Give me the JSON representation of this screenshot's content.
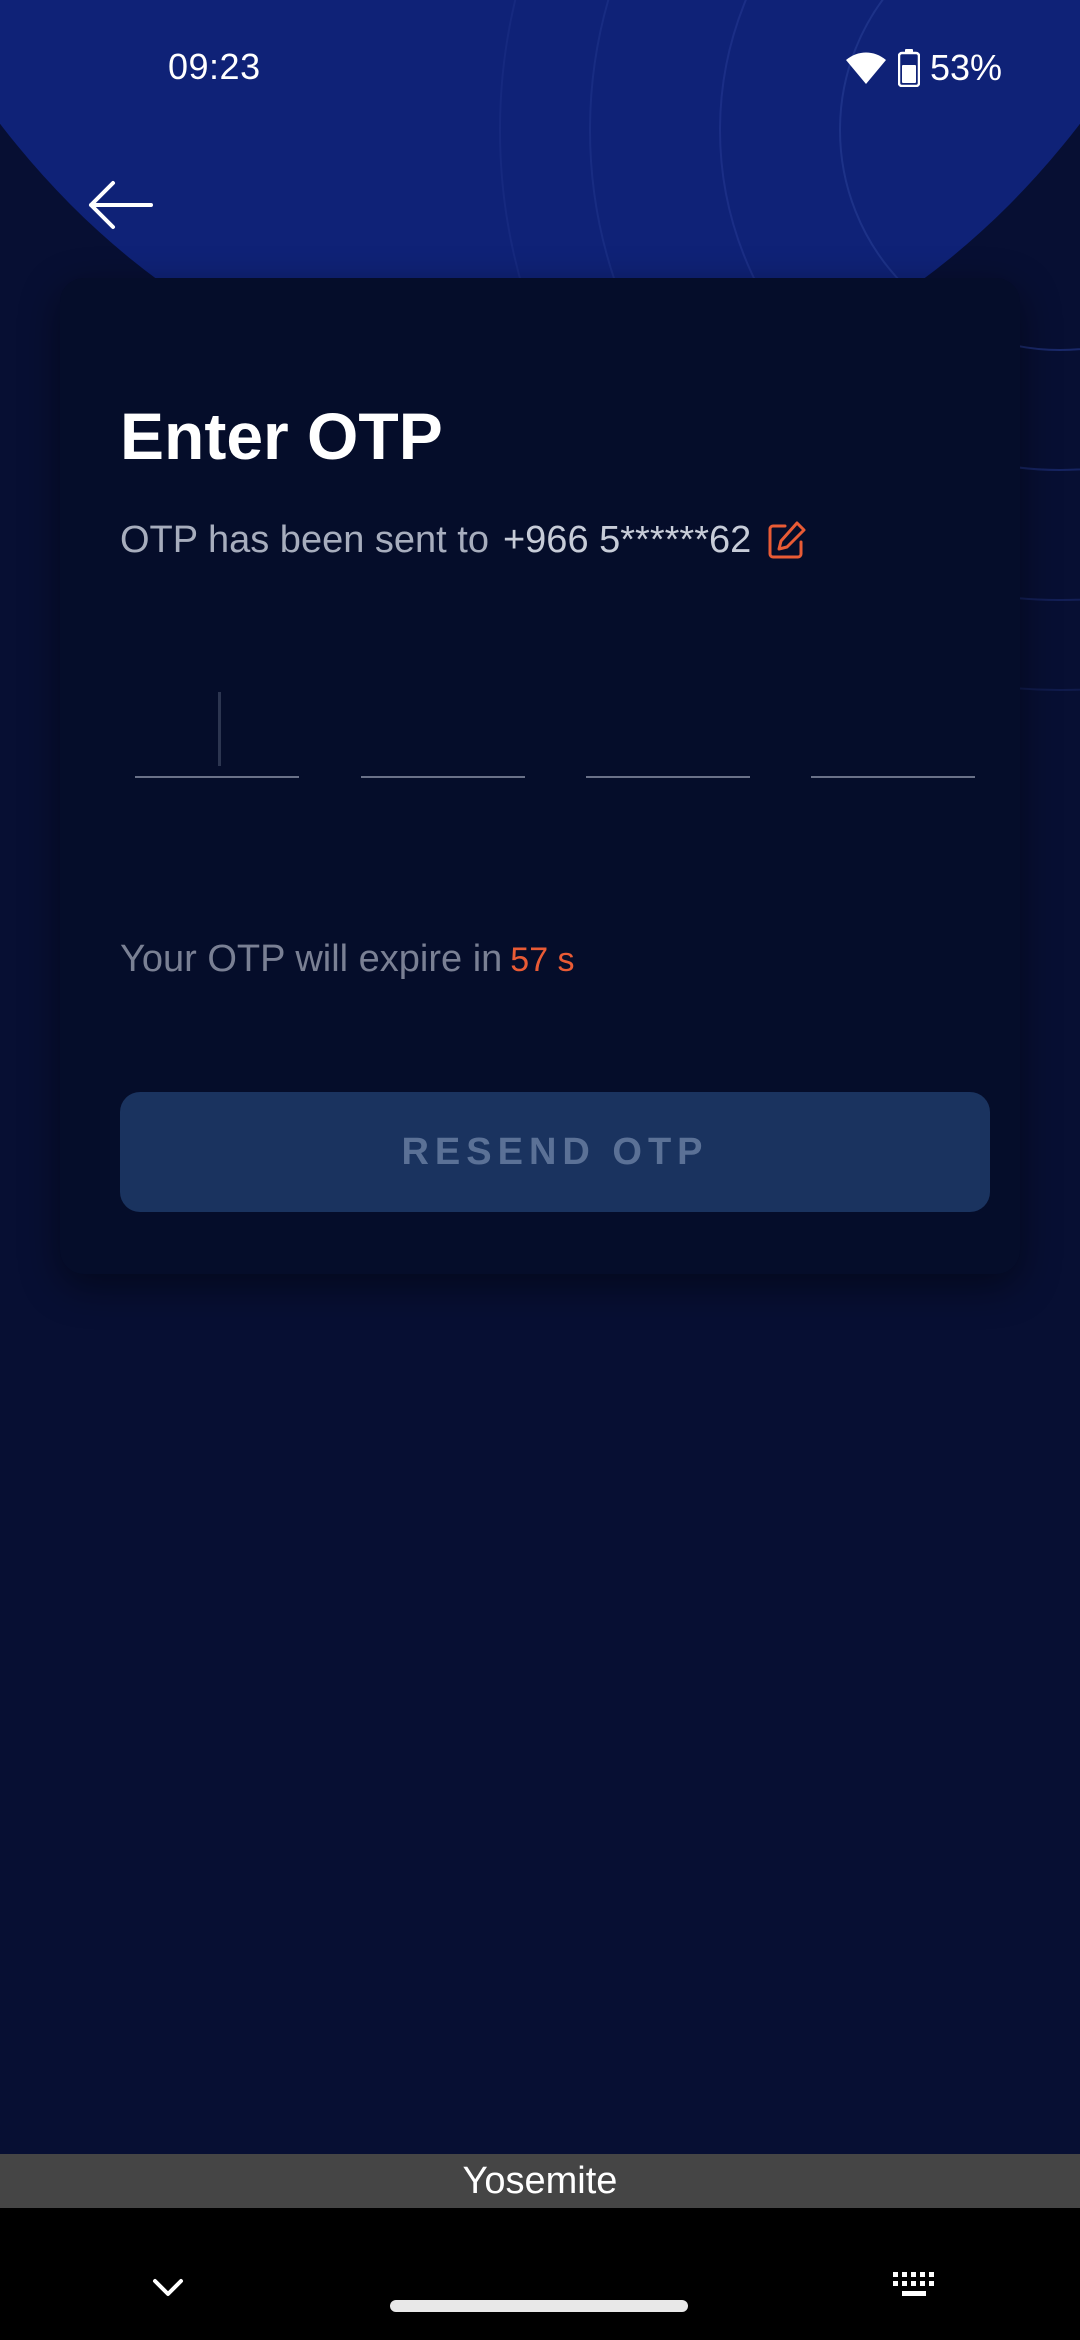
{
  "status_bar": {
    "time": "09:23",
    "battery": "53%",
    "icons": [
      "wifi-icon",
      "battery-icon"
    ]
  },
  "nav": {
    "back_icon": "arrow-left-icon"
  },
  "card": {
    "title": "Enter OTP",
    "subtitle_prefix": "OTP has been sent to",
    "phone": "+966 5******62",
    "edit_icon": "edit-icon",
    "otp_digits": [
      "",
      "",
      "",
      ""
    ],
    "expire_prefix": "Your OTP will expire in",
    "expire_count": "57 s",
    "resend_label": "RESEND OTP"
  },
  "keyboard": {
    "suggestion": "Yosemite",
    "icons": [
      "chevron-down-icon",
      "keyboard-icon"
    ]
  },
  "colors": {
    "background": "#070f33",
    "header": "#0f2277",
    "card": "#050d2a",
    "accent": "#e95b35",
    "button": "#1a335f",
    "button_text": "#5b7196"
  }
}
